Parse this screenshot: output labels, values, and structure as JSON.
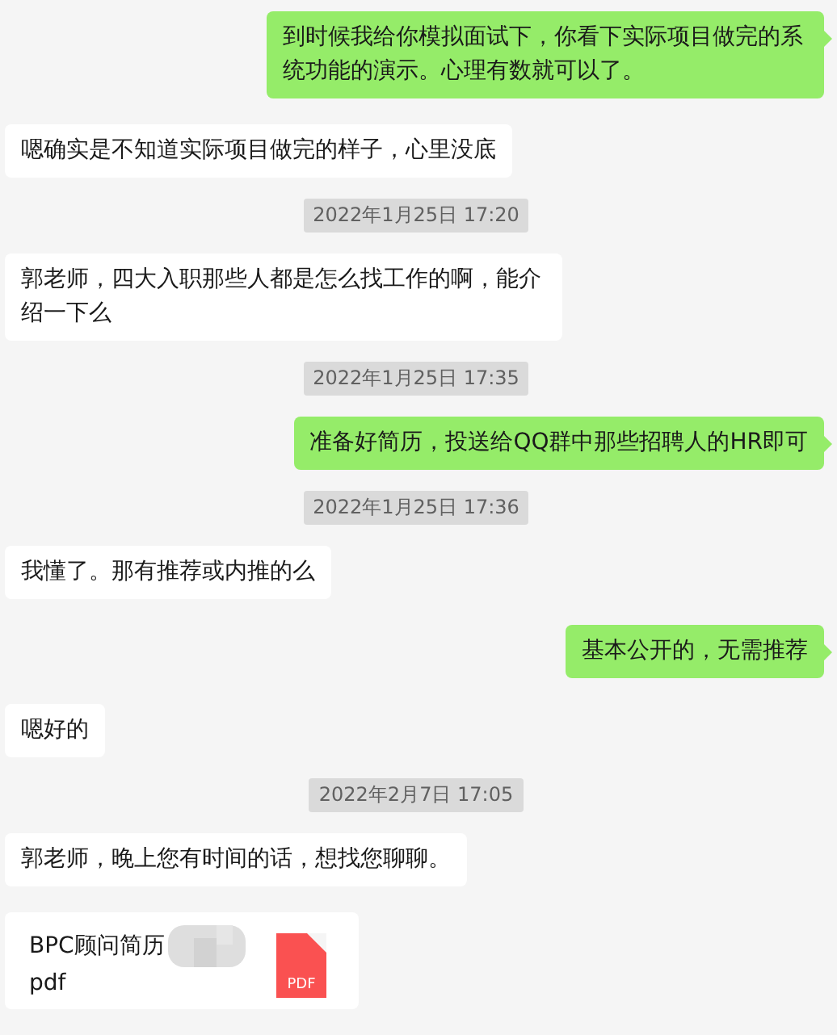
{
  "messages": [
    {
      "kind": "outgoing",
      "text": "到时候我给你模拟面试下，你看下实际项目做完的系统功能的演示。心理有数就可以了。"
    },
    {
      "kind": "incoming",
      "text": "嗯确实是不知道实际项目做完的样子，心里没底"
    },
    {
      "kind": "timestamp",
      "text": "2022年1月25日 17:20"
    },
    {
      "kind": "incoming",
      "text": "郭老师，四大入职那些人都是怎么找工作的啊，能介绍一下么"
    },
    {
      "kind": "timestamp",
      "text": "2022年1月25日 17:35"
    },
    {
      "kind": "outgoing",
      "text": "准备好简历，投送给QQ群中那些招聘人的HR即可"
    },
    {
      "kind": "timestamp",
      "text": "2022年1月25日 17:36"
    },
    {
      "kind": "incoming",
      "text": "我懂了。那有推荐或内推的么"
    },
    {
      "kind": "outgoing",
      "text": "基本公开的，无需推荐"
    },
    {
      "kind": "incoming",
      "text": "嗯好的"
    },
    {
      "kind": "timestamp",
      "text": "2022年2月7日 17:05"
    },
    {
      "kind": "incoming",
      "text": "郭老师，晚上您有时间的话，想找您聊聊。"
    },
    {
      "kind": "file",
      "name": "BPC顾问简历",
      "ext": "pdf",
      "icon_label": "PDF"
    }
  ]
}
